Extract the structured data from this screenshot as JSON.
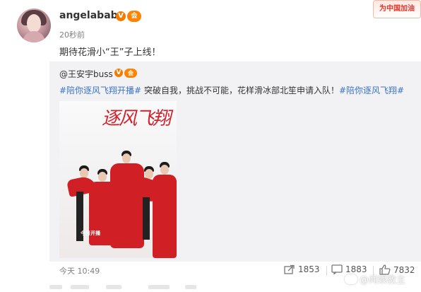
{
  "post": {
    "username": "angelababy",
    "verified_badge": "V",
    "member_badge": "会",
    "timestamp": "20秒前",
    "text": "期待花滑小“王”子上线！"
  },
  "promo": {
    "label": "为中国加油"
  },
  "repost": {
    "username": "@王安宇buss",
    "verified_badge": "V",
    "member_badge": "会",
    "hashtag1": "#陪你逐风飞翔开播#",
    "text_middle": " 突破自我，挑战不可能，花样滑冰部北笙申请入队！",
    "hashtag2": "#陪你逐风飞翔#",
    "poster": {
      "title": "逐风飞翔",
      "banner": "今日开播"
    }
  },
  "footer": {
    "time": "今天 10:49",
    "share_count": "1853",
    "comment_count": "1883",
    "like_count": "7832"
  },
  "watermark": {
    "text": "@闻娱教主"
  },
  "colors": {
    "accent": "#f47b00",
    "hashtag": "#3b73c9",
    "repost_bg": "#f2f2f5",
    "poster_red": "#d01f25"
  }
}
